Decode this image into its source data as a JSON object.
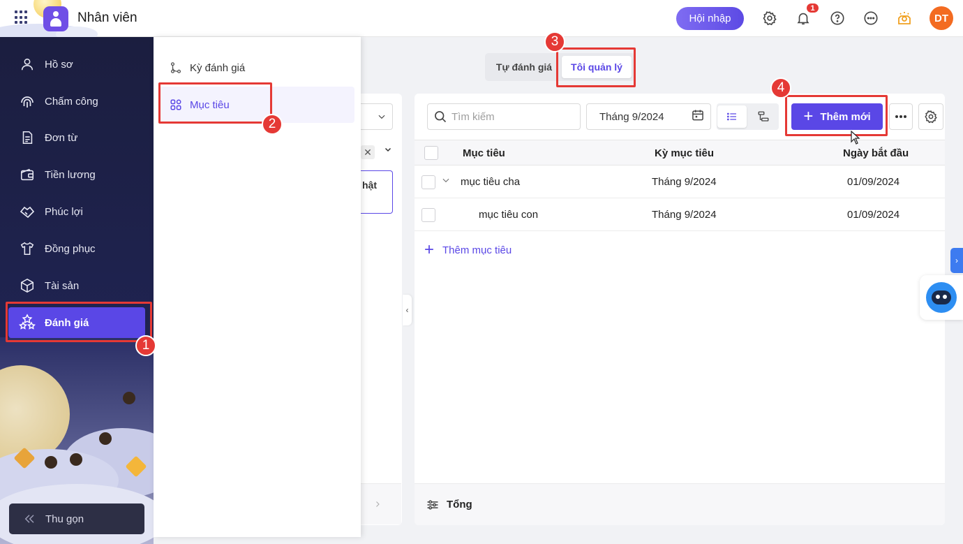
{
  "header": {
    "app_title": "Nhân viên",
    "integrate_label": "Hội nhập",
    "notification_count": "1",
    "avatar_initials": "DT"
  },
  "sidebar": {
    "items": [
      {
        "label": "Hồ sơ",
        "icon": "person-icon"
      },
      {
        "label": "Chấm công",
        "icon": "fingerprint-icon"
      },
      {
        "label": "Đơn từ",
        "icon": "document-icon"
      },
      {
        "label": "Tiền lương",
        "icon": "wallet-icon"
      },
      {
        "label": "Phúc lợi",
        "icon": "handshake-icon"
      },
      {
        "label": "Đồng phục",
        "icon": "shirt-icon"
      },
      {
        "label": "Tài sản",
        "icon": "box-icon"
      },
      {
        "label": "Đánh giá",
        "icon": "stars-icon"
      }
    ],
    "active_item": "Đánh giá",
    "collapse_label": "Thu gọn"
  },
  "submenu": {
    "items": [
      {
        "label": "Kỳ đánh giá",
        "icon": "branch-icon"
      },
      {
        "label": "Mục tiêu",
        "icon": "grid-icon"
      }
    ],
    "active_item": "Mục tiêu"
  },
  "middle_panel": {
    "card_text": "hật"
  },
  "tabs": [
    {
      "label": "Tự đánh giá"
    },
    {
      "label": "Tôi quản lý"
    }
  ],
  "active_tab": "Tôi quản lý",
  "toolbar": {
    "search_placeholder": "Tìm kiếm",
    "period_value": "Tháng 9/2024",
    "add_label": "Thêm mới"
  },
  "table": {
    "columns": [
      "Mục tiêu",
      "Kỳ mục tiêu",
      "Ngày bắt đầu"
    ],
    "rows": [
      {
        "goal": "mục tiêu cha",
        "period": "Tháng 9/2024",
        "start": "01/09/2024",
        "level": 0,
        "expandable": true
      },
      {
        "goal": "mục tiêu con",
        "period": "Tháng 9/2024",
        "start": "01/09/2024",
        "level": 1,
        "expandable": false
      }
    ],
    "add_goal_label": "Thêm mục tiêu",
    "footer_label": "Tổng"
  },
  "callouts": [
    "1",
    "2",
    "3",
    "4"
  ],
  "colors": {
    "primary": "#5a47e6",
    "callout": "#e53935",
    "avatar": "#f36b21",
    "sidebar_bg": "#1b1e3f"
  }
}
